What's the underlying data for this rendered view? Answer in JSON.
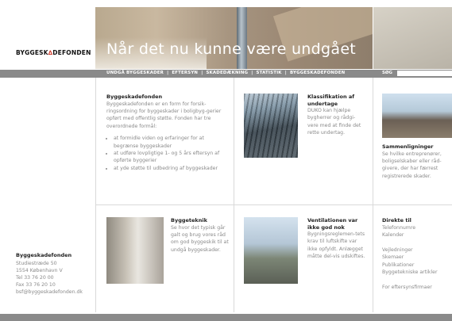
{
  "logo": {
    "pre": "BYGGESK",
    "delta": "∆",
    "post": "DEFONDEN"
  },
  "hero": {
    "title": "Når det nu kunne være undgået"
  },
  "nav": {
    "items": [
      "UNDGÅ BYGGESKADER",
      "|",
      "EFTERSYN",
      "|",
      "SKADEDÆKNING",
      "|",
      "STATISTIK",
      "|",
      "BYGGESKADEFONDEN"
    ],
    "search_label": "SØG",
    "search_value": ""
  },
  "intro": {
    "title": "Byggeskadefonden",
    "text": "Byggeskadefonden er en form for forsik-ringsordning for byggeskader i boligbyg-gerier opført med offentlig støtte. Fonden har tre overordnede formål:",
    "bullets": [
      "at formidle viden og erfaringer for at begrænse byggeskader",
      "at udføre lovpligtige 1- og 5 års eftersyn af opførte byggerier",
      "at yde støtte til udbedring af byggeskader"
    ]
  },
  "card1": {
    "title": "Klassifikation af undertage",
    "text": "DUKO kan hjælpe bygherrer og rådgi-vere med at finde det rette undertag."
  },
  "card2": {
    "title": "Sammenligninger",
    "text": "Se hvilke entreprenører, boligselskaber eller råd-givere, der har færrest registrerede skader."
  },
  "card3": {
    "title": "Byggeteknik",
    "text": "Se hvor det typisk går galt og brug vores råd om god byggeskik til at undgå byggeskader."
  },
  "card4": {
    "title": "Ventilationen var ikke god nok",
    "text": "Bygningsreglemen-tets krav til luftskifte var ikke opfyldt. Anlægget måtte del-vis udskiftes."
  },
  "address": {
    "name": "Byggeskadefonden",
    "lines": [
      "Studiestræde 50",
      "1554 København V",
      "Tel 33 76 20 00",
      "Fax 33 76 20 10",
      "bsf@byggeskadefonden.dk"
    ]
  },
  "direct": {
    "title": "Direkte til",
    "links_a": [
      "Telefonnumre",
      "Kalender"
    ],
    "links_b": [
      "Vejledninger",
      "Skemaer",
      "Publikationer",
      "Byggetekniske artikler"
    ],
    "links_c": [
      "For eftersynsfirmaer"
    ]
  }
}
